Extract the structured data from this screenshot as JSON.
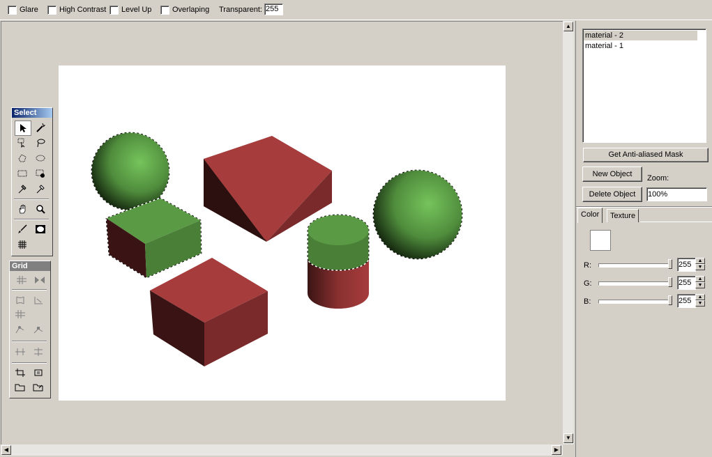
{
  "toolbar": {
    "options": [
      {
        "label": "Glare",
        "checked": false
      },
      {
        "label": "High Contrast",
        "checked": false
      },
      {
        "label": "Level Up",
        "checked": false
      },
      {
        "label": "Overlaping",
        "checked": false
      }
    ],
    "transparent_label": "Transparent:",
    "transparent_value": "255"
  },
  "select_palette": {
    "title": "Select",
    "title_color": "#0a246a",
    "tools": [
      "arrow-select-icon",
      "magic-wand-icon",
      "multi-select-icon",
      "lasso-icon",
      "polygon-select-icon",
      "ellipse-select-icon",
      "rect-select-icon",
      "add-select-icon",
      "pick-icon",
      "pick-alt-icon",
      "hand-pan-icon",
      "zoom-icon",
      "brush-icon",
      "mask-icon",
      "grid-icon"
    ]
  },
  "grid_palette": {
    "title": "Grid",
    "title_color": "#808080",
    "tools": [
      "grid-move-icon",
      "grid-mirror-icon",
      "grid-warp-icon",
      "grid-warp-alt-icon",
      "grid-add-icon",
      "grid-edit-icon",
      "grid-edit-alt-icon",
      "grid-align-h-icon",
      "grid-align-v-icon",
      "crop-icon",
      "crop-alt-icon",
      "folder-open-icon",
      "folder-save-icon"
    ]
  },
  "materials": {
    "items": [
      "material - 2",
      "material - 1"
    ],
    "selected_index": 0
  },
  "buttons": {
    "mask": "Get Anti-aliased Mask",
    "new_object": "New Object",
    "delete_object": "Delete Object"
  },
  "zoom": {
    "label": "Zoom:",
    "value": "100%"
  },
  "tabs": {
    "color": "Color",
    "texture": "Texture",
    "active": "Color"
  },
  "color_panel": {
    "swatch_color": "#ffffff",
    "channels": [
      {
        "label": "R:",
        "value": "255"
      },
      {
        "label": "G:",
        "value": "255"
      },
      {
        "label": "B:",
        "value": "255"
      }
    ]
  },
  "scene_colors": {
    "red_front": "#a63c3c",
    "red_side": "#7a2a2a",
    "red_dark": "#3a1414",
    "green": "#5a9a44",
    "green_light": "#6dbb55"
  }
}
